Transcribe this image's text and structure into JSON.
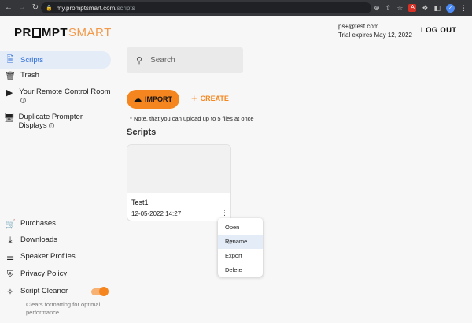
{
  "browser": {
    "url_host": "my.promptsmart.com",
    "url_path": "/scripts",
    "back_icon": "back-arrow-icon",
    "forward_icon": "forward-arrow-icon",
    "reload_icon": "reload-icon",
    "ext_red_letter": "A",
    "avatar_letter": "Z"
  },
  "header": {
    "logo_part1": "PR",
    "logo_part2": "MPT",
    "logo_part3": "SMART",
    "email": "ps+@test.com",
    "trial": "Trial expires May 12, 2022",
    "logout_label": "LOG OUT"
  },
  "sidebar": {
    "items": [
      {
        "label": "Scripts",
        "icon": "document-icon"
      },
      {
        "label": "Trash",
        "icon": "trash-icon"
      },
      {
        "label": "Your Remote Control Room",
        "icon": "remote-icon"
      },
      {
        "label": "Duplicate Prompter Displays",
        "icon": "display-icon"
      },
      {
        "label": "Purchases",
        "icon": "cart-icon"
      },
      {
        "label": "Downloads",
        "icon": "download-icon"
      },
      {
        "label": "Speaker Profiles",
        "icon": "speaker-icon"
      },
      {
        "label": "Privacy Policy",
        "icon": "shield-icon"
      },
      {
        "label": "Script Cleaner",
        "icon": "cleaner-icon"
      }
    ],
    "info_glyph": "i",
    "cleaner_desc": "Clears formatting for optimal performance."
  },
  "main": {
    "search_placeholder": "Search",
    "import_label": "IMPORT",
    "create_label": "CREATE",
    "note": "* Note, that you can upload up to 5 files at once",
    "section_title": "Scripts",
    "cards": [
      {
        "title": "Test1",
        "date": "12-05-2022 14:27"
      }
    ],
    "context_menu": [
      "Open",
      "Rename",
      "Export",
      "Delete"
    ]
  },
  "colors": {
    "accent": "#f5861f",
    "active_nav": "#2a6bd8",
    "active_bg": "#e4ecf7"
  }
}
